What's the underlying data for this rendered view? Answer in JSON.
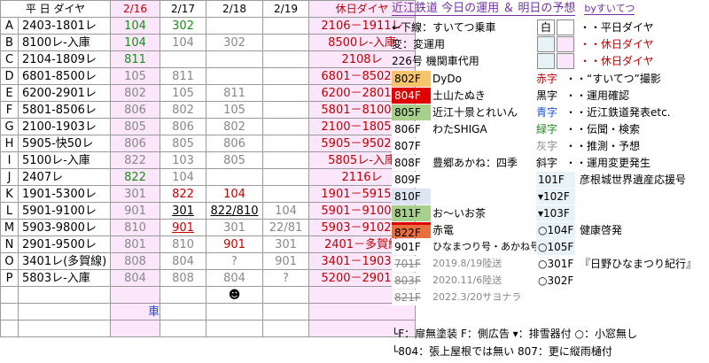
{
  "header": {
    "weekday": "平 日 ダイヤ",
    "d16": "2/16",
    "d17": "2/17",
    "d18": "2/18",
    "d19": "2/19",
    "holiday": "休日ダイヤ"
  },
  "rows": [
    {
      "k": "A",
      "w": "2403-1801レ",
      "a": "104",
      "b": "302",
      "c": "",
      "d": "",
      "h": "2106－1911レ"
    },
    {
      "k": "B",
      "w": "8100レ-入庫",
      "a": "104",
      "b": "104",
      "c": "302",
      "d": "",
      "h": "8500レ-入庫"
    },
    {
      "k": "C",
      "w": "2104-1809レ",
      "a": "811",
      "b": "",
      "c": "",
      "d": "",
      "h": "2108レ"
    },
    {
      "k": "D",
      "w": "6801-8500レ",
      "a": "105",
      "b": "811",
      "c": "",
      "d": "",
      "h": "6801－8502レ"
    },
    {
      "k": "E",
      "w": "6200-2901レ",
      "a": "802",
      "b": "105",
      "c": "811",
      "d": "",
      "h": "6200－2801レ"
    },
    {
      "k": "F",
      "w": "5801-8506レ",
      "a": "806",
      "b": "802",
      "c": "105",
      "d": "",
      "h": "5801－8100レ"
    },
    {
      "k": "G",
      "w": "2100-1903レ",
      "a": "805",
      "b": "806",
      "c": "802",
      "d": "",
      "h": "2100－1805レ"
    },
    {
      "k": "H",
      "w": "5905-快50レ",
      "a": "806",
      "b": "805",
      "c": "806",
      "d": "",
      "h": "5905－9502レ"
    },
    {
      "k": "I",
      "w": "5100レ-入庫",
      "a": "822",
      "b": "103",
      "c": "805",
      "d": "",
      "h": "5805レ-入庫"
    },
    {
      "k": "J",
      "w": "2407レ",
      "a": "822",
      "b": "104",
      "c": "",
      "d": "",
      "h": "2116レ"
    },
    {
      "k": "K",
      "w": "1901-5300レ",
      "a": "301",
      "b": "822",
      "c": "104",
      "d": "",
      "h": "1901－5915レ"
    },
    {
      "k": "L",
      "w": "5901-9100レ",
      "a": "901",
      "b": "301",
      "c": "822/810",
      "d": "104",
      "h": "5901－9100レ"
    },
    {
      "k": "M",
      "w": "5903-9800レ",
      "a": "810",
      "b": "901",
      "c": "301",
      "d": "22/81",
      "h": "5903－9102レ"
    },
    {
      "k": "N",
      "w": "2901-9500レ",
      "a": "801",
      "b": "810",
      "c": "901",
      "d": "301",
      "h": "2401－多賀線"
    },
    {
      "k": "O",
      "w": "3401レ(多賀線)",
      "a": "808",
      "b": "804",
      "c": "?",
      "d": "901",
      "h": "3401－1903レ"
    },
    {
      "k": "P",
      "w": "5803レ-入庫",
      "a": "804",
      "b": "808",
      "c": "804",
      "d": "?",
      "h": "5200－2901レ"
    }
  ],
  "footer": {
    "face": "☻",
    "cut": "車"
  },
  "panel": {
    "title": "近江鉄道 今日の運用 ＆ 明日の予想",
    "by": "byすいてつ",
    "legend": [
      {
        "t1": "←下線：すいてつ乗車",
        "box": "白",
        "t2": "・・平日ダイヤ"
      },
      {
        "t1": "変：変運用",
        "box": "",
        "t2": "・・休日ダイヤ"
      },
      {
        "t1": "226号 機関車代用",
        "box": "",
        "t2": "・・休日ダイヤ"
      }
    ],
    "trains": [
      {
        "n": "802F",
        "c": "#f6c56b",
        "fc": "#000",
        "d": "DyDo",
        "k": "赤字",
        "kc": "#c00000",
        "v": "・・“すいてつ”撮影"
      },
      {
        "n": "804F",
        "c": "#e00000",
        "fc": "#fff",
        "d": "土山たぬき",
        "k": "黒字",
        "kc": "#000",
        "v": "・・運用確認"
      },
      {
        "n": "805F",
        "c": "#a8d08d",
        "fc": "#000",
        "d": "近江十景とれいん",
        "k": "青字",
        "kc": "#1f4fd8",
        "v": "・・近江鉄道発表etc."
      },
      {
        "n": "806F",
        "c": "#fff",
        "fc": "#000",
        "d": "わたSHIGA",
        "k": "緑字",
        "kc": "#1e8a1e",
        "v": "・・伝聞・検索"
      },
      {
        "n": "807F",
        "c": "#fff",
        "fc": "#000",
        "d": "",
        "k": "灰字",
        "kc": "#888",
        "v": "・・推測・予想"
      },
      {
        "n": "808F",
        "c": "#fff",
        "fc": "#000",
        "d": "豊郷あかね：四季",
        "k": "斜字",
        "kc": "#000",
        "v": "・・運用変更発生"
      },
      {
        "n": "809F",
        "c": "#fff",
        "fc": "#000",
        "d": "",
        "k": "101F",
        "kc": "#000",
        "v": "彦根城世界遺産応援号"
      },
      {
        "n": "810F",
        "c": "#dce6f2",
        "fc": "#000",
        "d": "",
        "k": "▾102F",
        "kc": "#000",
        "v": ""
      },
      {
        "n": "811F",
        "c": "#a8d08d",
        "fc": "#000",
        "d": "お～いお茶",
        "k": "▾103F",
        "kc": "#000",
        "v": ""
      },
      {
        "n": "822F",
        "c": "#e87040",
        "fc": "#000",
        "d": "赤電",
        "k": "○104F",
        "kc": "#000",
        "v": "健康啓発"
      },
      {
        "n": "901F",
        "c": "#fff",
        "fc": "#000",
        "d": "ひなまつり号・あかね号",
        "k": "○105F",
        "kc": "#000",
        "v": ""
      },
      {
        "n": "701F",
        "c": "#fff",
        "fc": "#888",
        "d": "2019.8/19陸送",
        "k": "○301F",
        "kc": "#000",
        "v": "『日野ひなまつり紀行』"
      },
      {
        "n": "803F",
        "c": "#fff",
        "fc": "#888",
        "d": "2020.11/6陸送",
        "k": "○302F",
        "kc": "#000",
        "v": ""
      },
      {
        "n": "821F",
        "c": "#fff",
        "fc": "#888",
        "d": "2022.3/20サヨナラ",
        "k": "",
        "kc": "#000",
        "v": ""
      }
    ],
    "notes": [
      "└F：扉無塗装 F：側広告 ▾：排雪器付 ○：小窓無し",
      "└804：張上屋根では無い 807：更に縦雨樋付"
    ]
  }
}
